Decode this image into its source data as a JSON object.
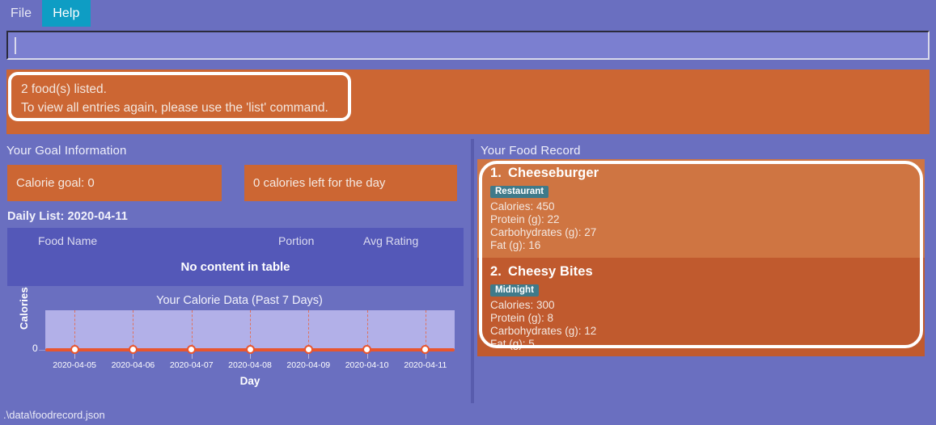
{
  "menu": {
    "items": [
      {
        "label": "File",
        "active": false
      },
      {
        "label": "Help",
        "active": true
      }
    ]
  },
  "command_input": {
    "value": "",
    "placeholder": ""
  },
  "message": {
    "line1": "2 food(s) listed.",
    "line2": "To view all entries again, please use the 'list' command."
  },
  "goal_panel": {
    "title": "Your Goal Information",
    "calorie_goal": "Calorie goal: 0",
    "calories_left": "0 calories left for the day"
  },
  "daily_list": {
    "title": "Daily List: 2020-04-11",
    "columns": [
      "Food Name",
      "Portion",
      "Avg Rating"
    ],
    "empty_text": "No content in table",
    "rows": []
  },
  "chart_data": {
    "type": "line",
    "title": "Your Calorie Data (Past 7 Days)",
    "xlabel": "Day",
    "ylabel": "Calories",
    "categories": [
      "2020-04-05",
      "2020-04-06",
      "2020-04-07",
      "2020-04-08",
      "2020-04-09",
      "2020-04-10",
      "2020-04-11"
    ],
    "values": [
      0,
      0,
      0,
      0,
      0,
      0,
      0
    ],
    "ylim": [
      0,
      1
    ],
    "yticks": [
      "0"
    ],
    "grid": true,
    "gridline_style": "dashed-vertical",
    "legend": "none",
    "series_color": "#e8552e",
    "plot_bg": "#b2b0e8"
  },
  "food_record": {
    "title": "Your Food Record",
    "items": [
      {
        "index": "1.",
        "name": "Cheeseburger",
        "tag": "Restaurant",
        "calories": "Calories: 450",
        "protein": "Protein (g): 22",
        "carbs": "Carbohydrates (g): 27",
        "fat": "Fat (g): 16",
        "selected": true
      },
      {
        "index": "2.",
        "name": "Cheesy Bites",
        "tag": "Midnight",
        "calories": "Calories: 300",
        "protein": "Protein (g): 8",
        "carbs": "Carbohydrates (g): 12",
        "fat": "Fat (g): 5",
        "selected": false
      }
    ]
  },
  "status_bar": {
    "path": ".\\data\\foodrecord.json"
  },
  "colors": {
    "background": "#6a6fc0",
    "accent_orange": "#cc6633",
    "accent_orange_selected": "#cf7542",
    "accent_orange_normal": "#c05a2e",
    "menu_active": "#0e9dc4",
    "tag_bg": "#3f7a8a",
    "table_bg": "#5458b8",
    "highlight_border": "#ffffff"
  }
}
